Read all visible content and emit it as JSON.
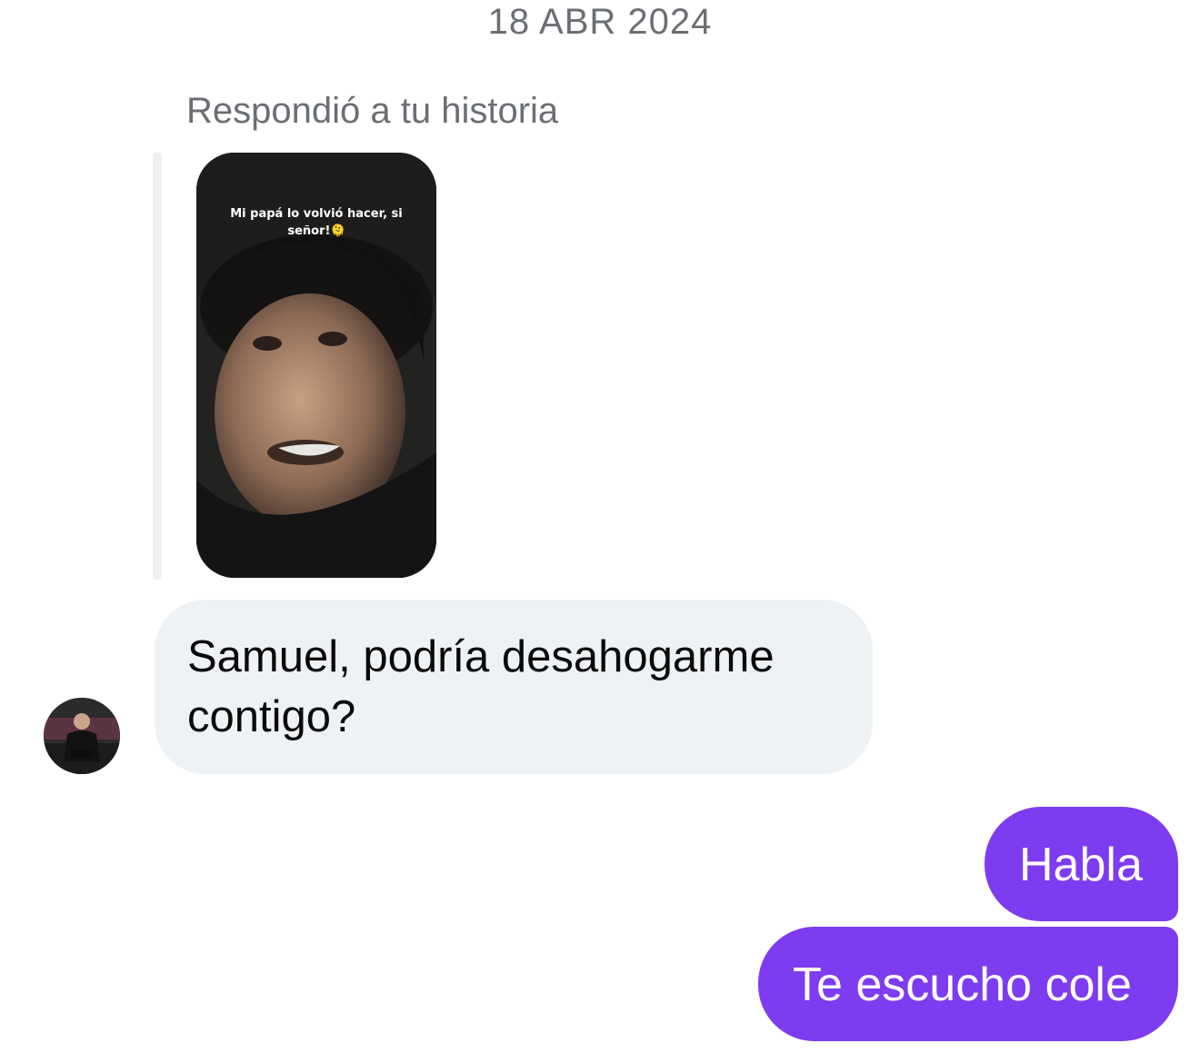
{
  "conversation": {
    "date_label": "18 ABR 2024",
    "story_reply_label": "Respondió a tu historia",
    "story": {
      "caption": "Mi papá lo volvió hacer, si señor!🫠"
    },
    "incoming_message": "Samuel, podría desahogarme contigo?",
    "outgoing_messages": [
      "Habla",
      "Te escucho cole"
    ]
  },
  "colors": {
    "outgoing_bubble": "#7d3cf0",
    "incoming_bubble": "#eff2f5",
    "meta_text": "#6b6f74"
  },
  "icons": {
    "avatar": "user-avatar-photo"
  }
}
